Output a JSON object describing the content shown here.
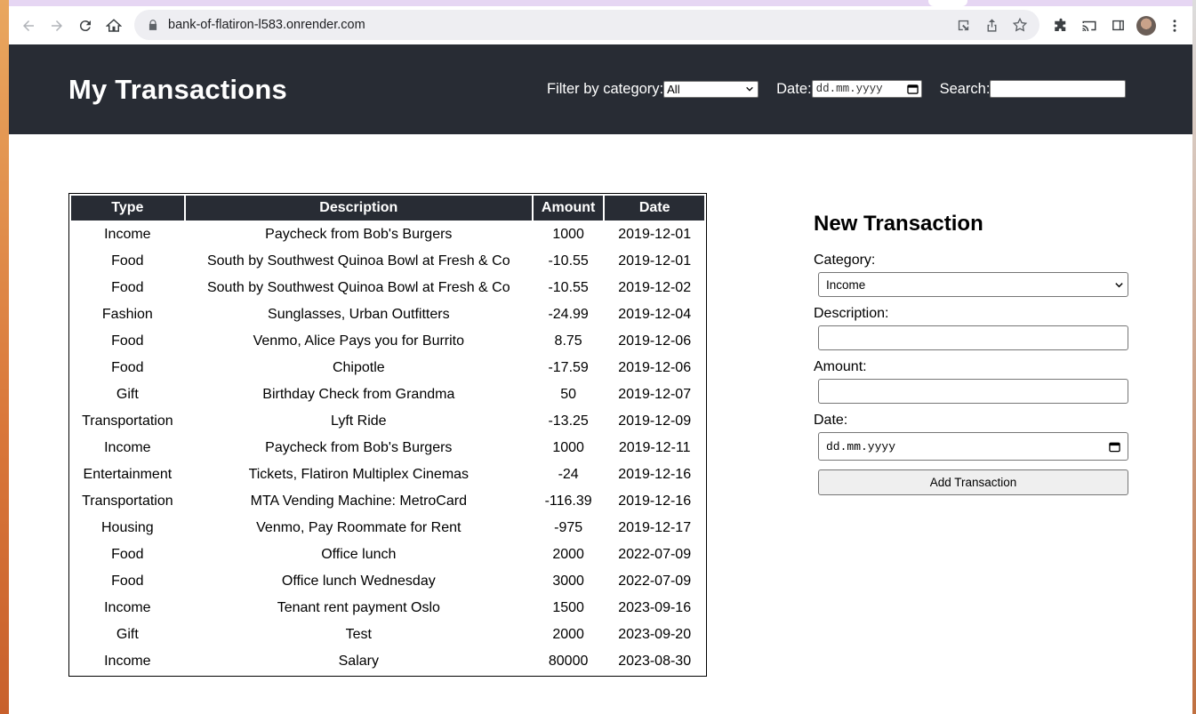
{
  "browser": {
    "url": "bank-of-flatiron-l583.onrender.com"
  },
  "header": {
    "title": "My Transactions",
    "filter_label": "Filter by category:",
    "filter_value": "All",
    "date_label": "Date:",
    "date_placeholder": "dd.mm.yyyy",
    "search_label": "Search:",
    "search_value": ""
  },
  "table": {
    "columns": [
      "Type",
      "Description",
      "Amount",
      "Date"
    ],
    "rows": [
      [
        "Income",
        "Paycheck from Bob's Burgers",
        "1000",
        "2019-12-01"
      ],
      [
        "Food",
        "South by Southwest Quinoa Bowl at Fresh & Co",
        "-10.55",
        "2019-12-01"
      ],
      [
        "Food",
        "South by Southwest Quinoa Bowl at Fresh & Co",
        "-10.55",
        "2019-12-02"
      ],
      [
        "Fashion",
        "Sunglasses, Urban Outfitters",
        "-24.99",
        "2019-12-04"
      ],
      [
        "Food",
        "Venmo, Alice Pays you for Burrito",
        "8.75",
        "2019-12-06"
      ],
      [
        "Food",
        "Chipotle",
        "-17.59",
        "2019-12-06"
      ],
      [
        "Gift",
        "Birthday Check from Grandma",
        "50",
        "2019-12-07"
      ],
      [
        "Transportation",
        "Lyft Ride",
        "-13.25",
        "2019-12-09"
      ],
      [
        "Income",
        "Paycheck from Bob's Burgers",
        "1000",
        "2019-12-11"
      ],
      [
        "Entertainment",
        "Tickets, Flatiron Multiplex Cinemas",
        "-24",
        "2019-12-16"
      ],
      [
        "Transportation",
        "MTA Vending Machine: MetroCard",
        "-116.39",
        "2019-12-16"
      ],
      [
        "Housing",
        "Venmo, Pay Roommate for Rent",
        "-975",
        "2019-12-17"
      ],
      [
        "Food",
        "Office lunch",
        "2000",
        "2022-07-09"
      ],
      [
        "Food",
        "Office lunch Wednesday",
        "3000",
        "2022-07-09"
      ],
      [
        "Income",
        "Tenant rent payment Oslo",
        "1500",
        "2023-09-16"
      ],
      [
        "Gift",
        "Test",
        "2000",
        "2023-09-20"
      ],
      [
        "Income",
        "Salary",
        "80000",
        "2023-08-30"
      ]
    ]
  },
  "form": {
    "title": "New Transaction",
    "category_label": "Category:",
    "category_value": "Income",
    "description_label": "Description:",
    "description_value": "",
    "amount_label": "Amount:",
    "amount_value": "",
    "date_label": "Date:",
    "date_placeholder": "dd.mm.yyyy",
    "submit_label": "Add Transaction"
  },
  "colors": {
    "header_bg": "#282c34",
    "tab_strip": "#e6d6f3"
  }
}
